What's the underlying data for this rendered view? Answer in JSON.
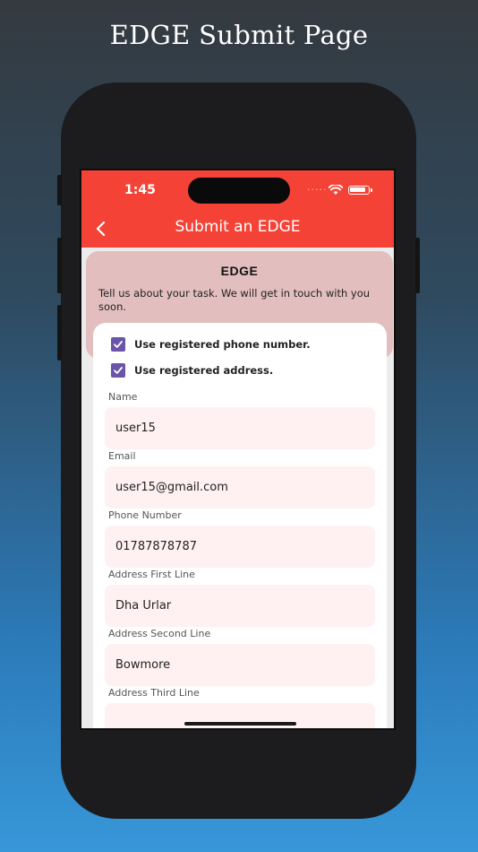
{
  "headline": "EDGE Submit Page",
  "status": {
    "time": "1:45",
    "dots": "....."
  },
  "header": {
    "title": "Submit an EDGE"
  },
  "card": {
    "logo": "EDGE",
    "tagline": "Tell us about your task. We will get in touch with you soon."
  },
  "checks": [
    {
      "label": "Use registered phone number.",
      "checked": true
    },
    {
      "label": "Use registered address.",
      "checked": true
    }
  ],
  "fields": [
    {
      "label": "Name",
      "value": "user15"
    },
    {
      "label": "Email",
      "value": "user15@gmail.com"
    },
    {
      "label": "Phone Number",
      "value": "01787878787"
    },
    {
      "label": "Address  First Line",
      "value": "Dha Urlar"
    },
    {
      "label": "Address  Second Line",
      "value": "Bowmore"
    },
    {
      "label": "Address  Third Line",
      "value": ""
    }
  ],
  "colors": {
    "accent": "#f44336",
    "checkbox": "#6a55a8",
    "field_bg": "#fff1f1",
    "card_bg": "#e2bfbe"
  }
}
